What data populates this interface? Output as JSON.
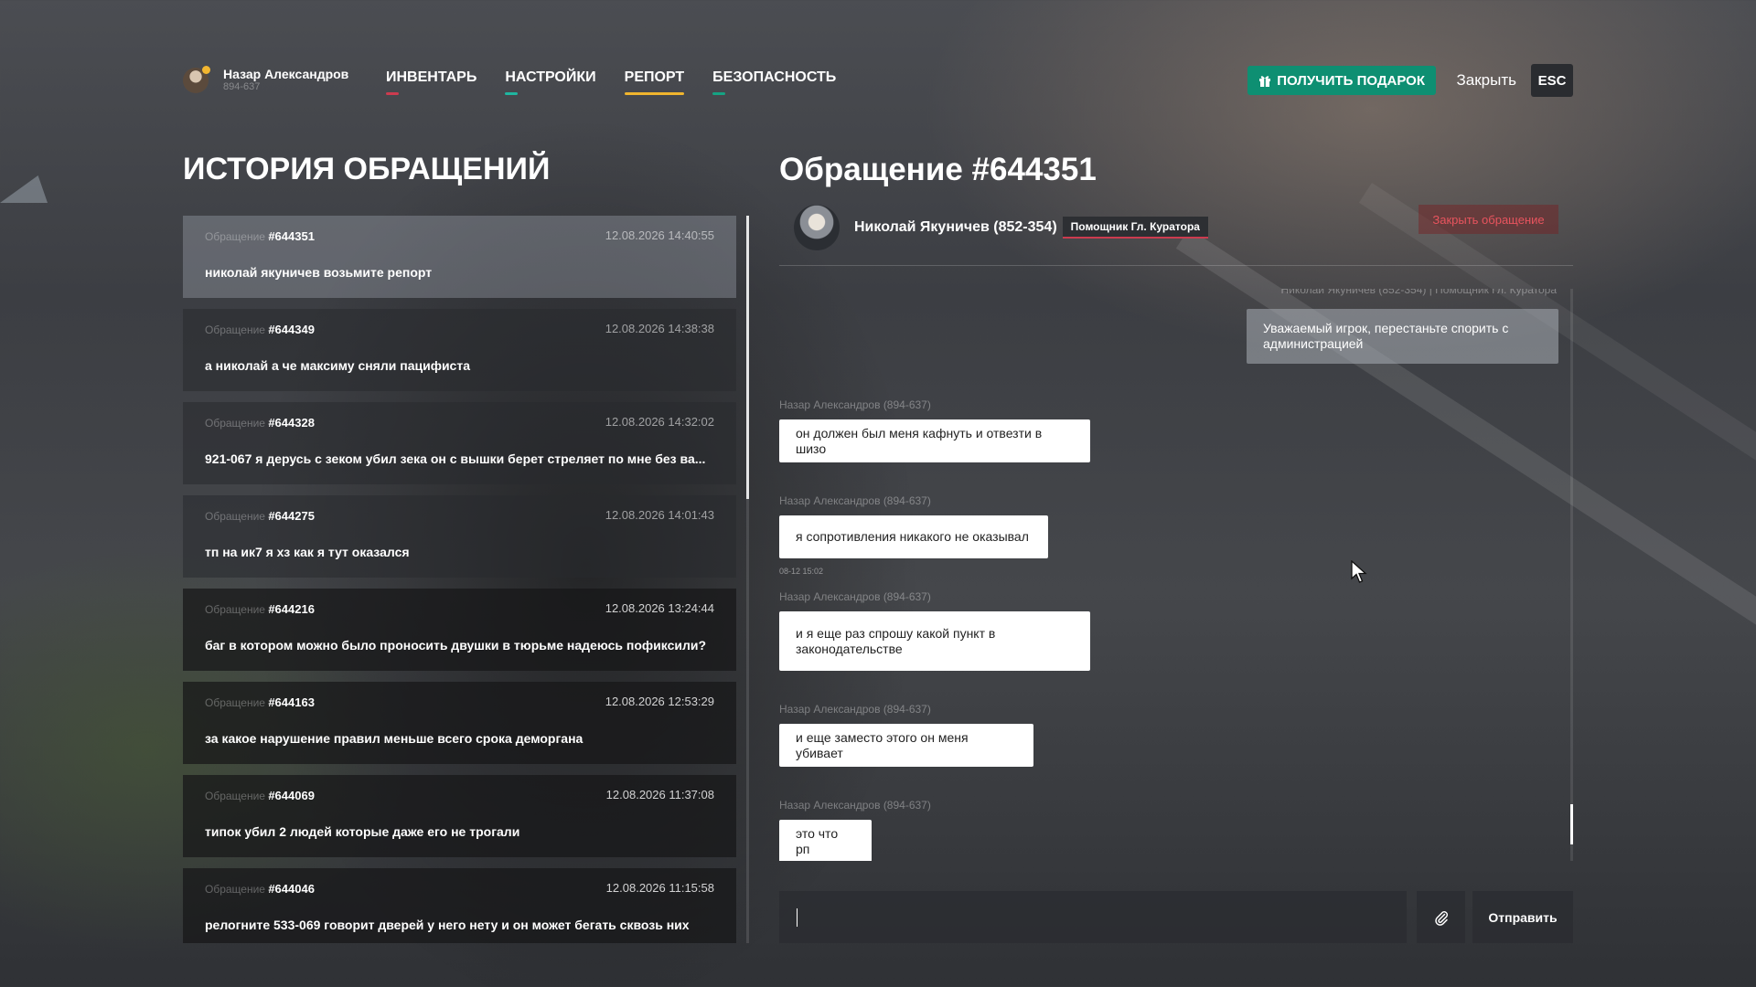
{
  "profile": {
    "name": "Назар Александров",
    "id": "894-637"
  },
  "nav": [
    {
      "label": "Инвентарь",
      "color": "#cc3b4f",
      "active": false
    },
    {
      "label": "Настройки",
      "color": "#1fb6a0",
      "active": false
    },
    {
      "label": "Репорт",
      "color": "#f0b52e",
      "active": true
    },
    {
      "label": "Безопасность",
      "color": "#15a383",
      "active": false
    }
  ],
  "topbar": {
    "gift_label": "ПОЛУЧИТЬ ПОДАРОК",
    "close_label": "Закрыть",
    "esc_label": "ESC"
  },
  "history": {
    "title": "ИСТОРИЯ ОБРАЩЕНИЙ",
    "items": [
      {
        "prefix": "Обращение",
        "number": "#644351",
        "date": "12.08.2026 14:40:55",
        "text": "николай якуничев возьмите репорт"
      },
      {
        "prefix": "Обращение",
        "number": "#644349",
        "date": "12.08.2026 14:38:38",
        "text": "а николай а че максиму сняли пацифиста"
      },
      {
        "prefix": "Обращение",
        "number": "#644328",
        "date": "12.08.2026 14:32:02",
        "text": "921-067 я дерусь с зеком убил зека он с вышки берет стреляет по мне без ва..."
      },
      {
        "prefix": "Обращение",
        "number": "#644275",
        "date": "12.08.2026 14:01:43",
        "text": "тп на ик7 я хз как я тут оказался"
      },
      {
        "prefix": "Обращение",
        "number": "#644216",
        "date": "12.08.2026 13:24:44",
        "text": "баг в котором можно было проносить двушки в тюрьме надеюсь пофиксили?"
      },
      {
        "prefix": "Обращение",
        "number": "#644163",
        "date": "12.08.2026 12:53:29",
        "text": "за какое нарушение правил меньше всего срока деморгана"
      },
      {
        "prefix": "Обращение",
        "number": "#644069",
        "date": "12.08.2026 11:37:08",
        "text": "типок убил 2 людей которые даже его не трогали"
      },
      {
        "prefix": "Обращение",
        "number": "#644046",
        "date": "12.08.2026 11:15:58",
        "text": "релогните 533-069 говорит дверей у него нету и он может бегать сквозь них"
      }
    ]
  },
  "ticket": {
    "title": "Обращение #644351",
    "admin_name": "Николай Якуничев (852-354)",
    "admin_role": "Помощник Гл. Куратора",
    "close_label": "Закрыть обращение"
  },
  "messages": [
    {
      "author": "Николай Якуничев (852-354) | Помощник Гл. Куратора",
      "text": "Уважаемый игрок, перестаньте спорить с администрацией",
      "mine": false
    },
    {
      "author": "Назар Александров (894-637)",
      "text": "он должен был меня кафнуть и отвезти в шизо",
      "mine": true
    },
    {
      "author": "Назар Александров (894-637)",
      "text": "я сопротивления никакого не оказывал",
      "mine": true,
      "time": "08-12 15:02"
    },
    {
      "author": "Назар Александров (894-637)",
      "text": "и я еще раз спрошу какой пункт в законодательстве",
      "mine": true
    },
    {
      "author": "Назар Александров (894-637)",
      "text": "и еще заместо этого он меня убивает",
      "mine": true
    },
    {
      "author": "Назар Александров (894-637)",
      "text": "это что рп",
      "mine": true
    }
  ],
  "composer": {
    "value": "",
    "placeholder": "",
    "send_label": "Отправить"
  }
}
